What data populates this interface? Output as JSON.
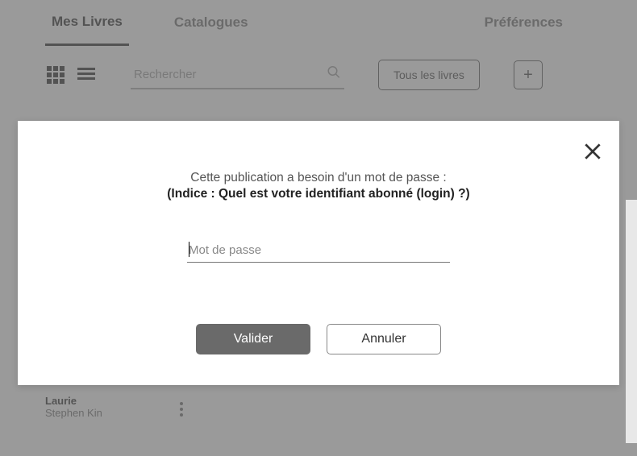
{
  "tabs": {
    "books": "Mes Livres",
    "catalogues": "Catalogues",
    "preferences": "Préférences"
  },
  "toolbar": {
    "search_placeholder": "Rechercher",
    "filter_label": "Tous les livres",
    "add_label": "+"
  },
  "book": {
    "title": "Laurie",
    "author": "Stephen Kin"
  },
  "modal": {
    "line1": "Cette publication a besoin d'un mot de passe :",
    "line2": "(Indice : Quel est votre identifiant abonné (login) ?)",
    "password_placeholder": "Mot de passe",
    "validate": "Valider",
    "cancel": "Annuler"
  }
}
